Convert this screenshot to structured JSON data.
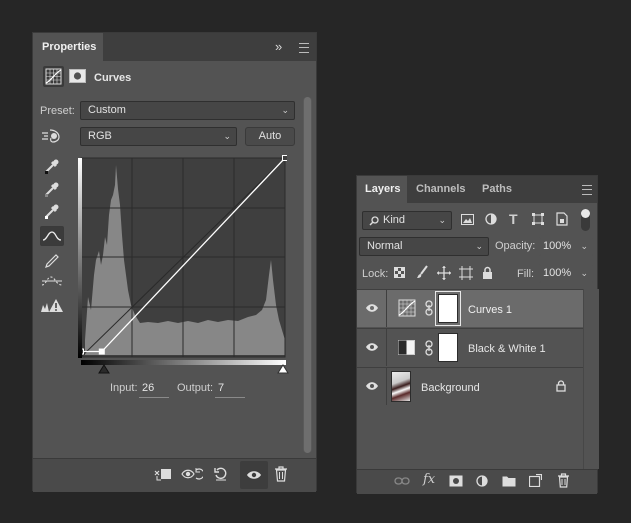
{
  "properties": {
    "tab": "Properties",
    "collapse_glyph": "»",
    "adjustment_title": "Curves",
    "preset_label": "Preset:",
    "preset_value": "Custom",
    "channel_value": "RGB",
    "auto_label": "Auto",
    "input_label": "Input:",
    "input_value": "26",
    "output_label": "Output:",
    "output_value": "7",
    "tools": [
      "sample-black-eyedropper-icon",
      "sample-gray-eyedropper-icon",
      "sample-white-eyedropper-icon",
      "curve-point-tool-icon",
      "pencil-draw-icon",
      "smooth-curve-icon",
      "clipping-warning-icon"
    ],
    "footer_icons": [
      "clip-to-layer-icon",
      "view-previous-state-icon",
      "reset-icon",
      "toggle-visibility-icon",
      "delete-icon"
    ]
  },
  "layers": {
    "tabs": [
      "Layers",
      "Channels",
      "Paths"
    ],
    "filter_kind": "Kind",
    "blend_mode": "Normal",
    "opacity_label": "Opacity:",
    "opacity_value": "100%",
    "lock_label": "Lock:",
    "fill_label": "Fill:",
    "fill_value": "100%",
    "items": [
      {
        "name": "Curves 1",
        "selected": true
      },
      {
        "name": "Black & White 1",
        "selected": false
      },
      {
        "name": "Background",
        "selected": false,
        "locked": true
      }
    ],
    "footer_icons": [
      "link-layers-icon",
      "fx-icon",
      "add-mask-icon",
      "new-adjustment-layer-icon",
      "new-group-icon",
      "new-layer-icon",
      "delete-layer-icon"
    ]
  },
  "chart_data": {
    "type": "line",
    "title": "",
    "xlabel": "",
    "ylabel": "",
    "xlim": [
      0,
      255
    ],
    "ylim": [
      0,
      255
    ],
    "grid": true,
    "series": [
      {
        "values": [
          [
            0,
            7
          ],
          [
            26,
            7
          ],
          [
            255,
            255
          ]
        ]
      }
    ]
  }
}
